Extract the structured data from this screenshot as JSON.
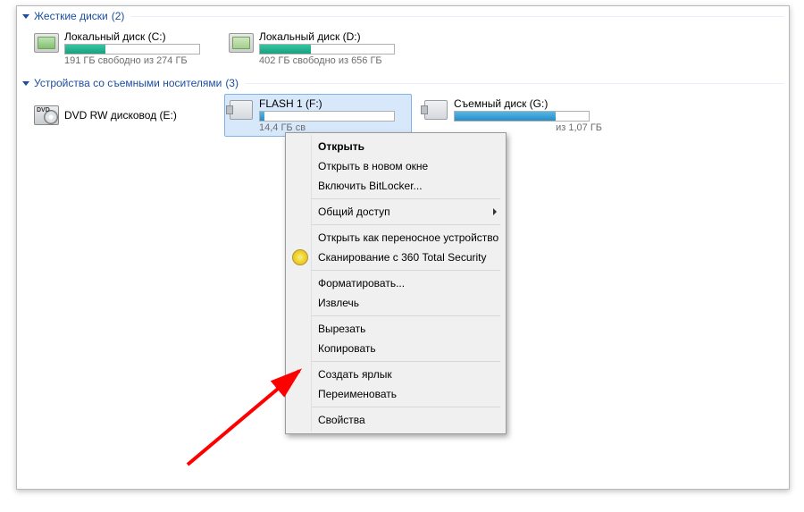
{
  "groups": {
    "hdd": {
      "title": "Жесткие диски",
      "count": "(2)"
    },
    "removable": {
      "title": "Устройства со съемными носителями",
      "count": "(3)"
    }
  },
  "drives": {
    "c": {
      "name": "Локальный диск (C:)",
      "sub": "191 ГБ свободно из 274 ГБ",
      "fill_pct": 30
    },
    "d": {
      "name": "Локальный диск (D:)",
      "sub": "402 ГБ свободно из 656 ГБ",
      "fill_pct": 38
    },
    "dvd": {
      "name": "DVD RW дисковод (E:)"
    },
    "f": {
      "name": "FLASH 1 (F:)",
      "sub": "14,4 ГБ св",
      "fill_pct": 3
    },
    "g": {
      "name": "Съемный диск (G:)",
      "sub_suffix": " из 1,07 ГБ",
      "fill_pct": 75
    }
  },
  "menu": {
    "open": "Открыть",
    "open_new": "Открыть в новом окне",
    "bitlocker": "Включить BitLocker...",
    "share": "Общий доступ",
    "portable": "Открыть как переносное устройство",
    "scan360": "Сканирование с 360 Total Security",
    "format": "Форматировать...",
    "eject": "Извлечь",
    "cut": "Вырезать",
    "copy": "Копировать",
    "shortcut": "Создать ярлык",
    "rename": "Переименовать",
    "properties": "Свойства"
  }
}
